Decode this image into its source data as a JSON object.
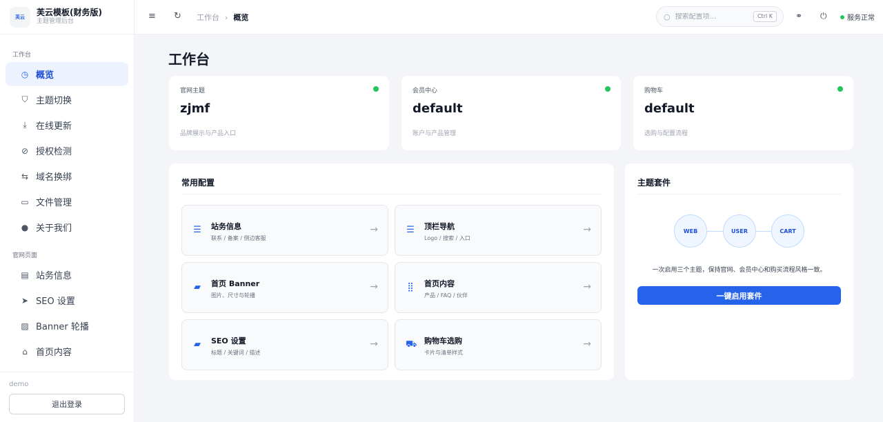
{
  "brand": {
    "logo_text": "芙云",
    "title": "芙云模板(财务版)",
    "subtitle": "主题管理后台"
  },
  "sidebar": {
    "section1": "工作台",
    "section2": "官网页面",
    "items": [
      {
        "label": "概览",
        "icon": "dashboard-icon"
      },
      {
        "label": "主题切换",
        "icon": "theme-icon"
      },
      {
        "label": "在线更新",
        "icon": "download-icon"
      },
      {
        "label": "授权检测",
        "icon": "check-circle-icon"
      },
      {
        "label": "域名换绑",
        "icon": "swap-icon"
      },
      {
        "label": "文件管理",
        "icon": "folder-icon"
      },
      {
        "label": "关于我们",
        "icon": "info-icon"
      },
      {
        "label": "站务信息",
        "icon": "building-icon"
      },
      {
        "label": "SEO 设置",
        "icon": "send-icon"
      },
      {
        "label": "Banner 轮播",
        "icon": "image-icon"
      },
      {
        "label": "首页内容",
        "icon": "home-icon"
      }
    ],
    "user": "demo",
    "logout_label": "退出登录"
  },
  "topbar": {
    "breadcrumb": [
      "工作台",
      "概览"
    ],
    "search_placeholder": "搜索配置项...",
    "shortcut": "Ctrl K",
    "status_text": "服务正常"
  },
  "page_title": "工作台",
  "stats": [
    {
      "label": "官网主题",
      "value": "zjmf",
      "desc": "品牌展示与产品入口"
    },
    {
      "label": "会员中心",
      "value": "default",
      "desc": "账户与产品管理"
    },
    {
      "label": "购物车",
      "value": "default",
      "desc": "选购与配置流程"
    }
  ],
  "common_config": {
    "title": "常用配置",
    "items": [
      {
        "title": "站务信息",
        "desc": "联系 / 备案 / 侧边客服",
        "icon": "list-icon"
      },
      {
        "title": "顶栏导航",
        "desc": "Logo / 搜索 / 入口",
        "icon": "list-icon"
      },
      {
        "title": "首页 Banner",
        "desc": "图片、尺寸与轮播",
        "icon": "image-icon"
      },
      {
        "title": "首页内容",
        "desc": "产品 / FAQ / 伙伴",
        "icon": "grid-icon"
      },
      {
        "title": "SEO 设置",
        "desc": "标题 / 关键词 / 描述",
        "icon": "image-icon"
      },
      {
        "title": "购物车选购",
        "desc": "卡片与清单样式",
        "icon": "cart-icon"
      }
    ]
  },
  "theme_suite": {
    "title": "主题套件",
    "nodes": [
      "WEB",
      "USER",
      "CART"
    ],
    "description": "一次启用三个主题，保持官网、会员中心和购买流程风格一致。",
    "button_label": "一键启用套件"
  },
  "colors": {
    "accent": "#2563eb",
    "status_ok": "#22c55e"
  }
}
